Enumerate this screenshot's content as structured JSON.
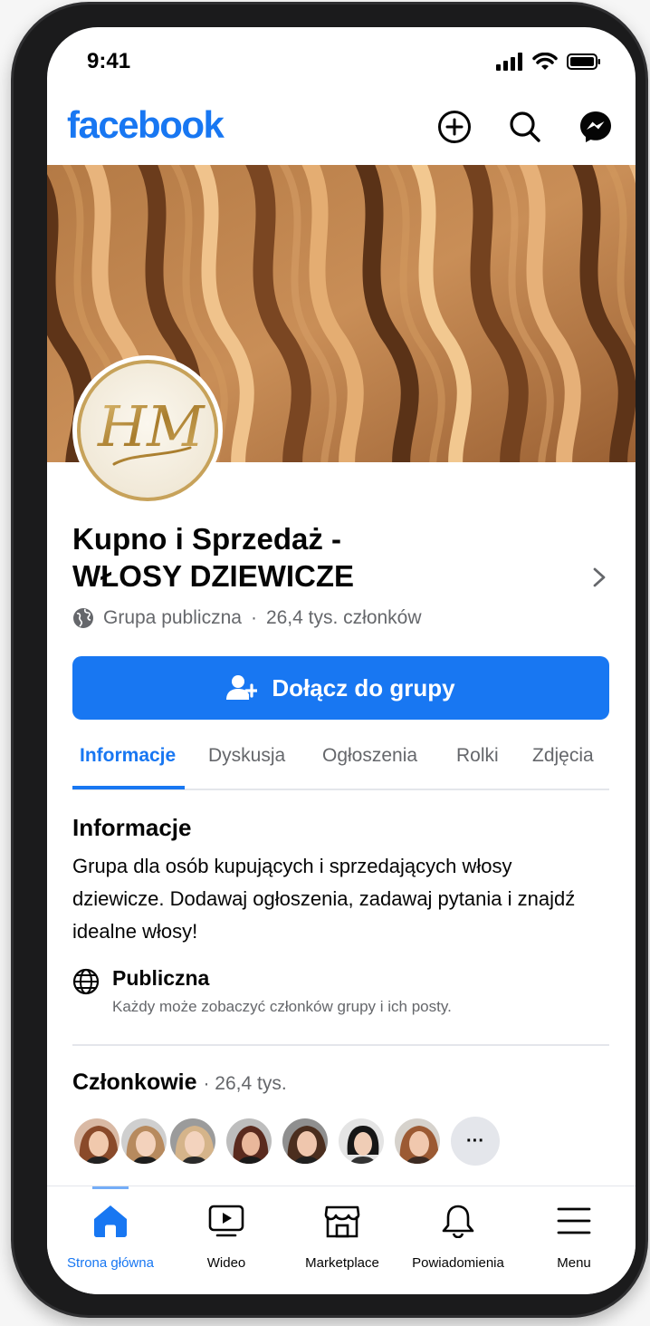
{
  "status_bar": {
    "time": "9:41"
  },
  "header": {
    "logo": "facebook",
    "icons": [
      "plus-circle-icon",
      "search-icon",
      "messenger-icon"
    ]
  },
  "group": {
    "logo_monogram": "HM",
    "title_line1": "Kupno i Sprzedaż -",
    "title_line2": "WŁOSY DZIEWICZE",
    "privacy": "Grupa publiczna",
    "members_short": "26,4 tys. członków",
    "join_label": "Dołącz do grupy"
  },
  "tabs": [
    "Informacje",
    "Dyskusja",
    "Ogłoszenia",
    "Rolki",
    "Zdjęcia"
  ],
  "info": {
    "title": "Informacje",
    "description": "Grupa dla osób kupujących i sprzedających włosy dziewicze. Dodawaj ogłoszenia, zadawaj pytania i znajdź idealne włosy!",
    "privacy_title": "Publiczna",
    "privacy_desc": "Każdy może zobaczyć członków grupy i ich posty."
  },
  "members": {
    "title": "Członkowie",
    "count": "· 26,4 tys.",
    "more_label": "···"
  },
  "bottom_nav": [
    {
      "label": "Strona główna",
      "icon": "home-icon"
    },
    {
      "label": "Wideo",
      "icon": "video-icon"
    },
    {
      "label": "Marketplace",
      "icon": "marketplace-icon"
    },
    {
      "label": "Powiadomienia",
      "icon": "bell-icon"
    },
    {
      "label": "Menu",
      "icon": "menu-icon"
    }
  ],
  "colors": {
    "brand": "#1877f2",
    "text": "#050505",
    "secondary_text": "#65676b",
    "divider": "#e4e6eb"
  }
}
